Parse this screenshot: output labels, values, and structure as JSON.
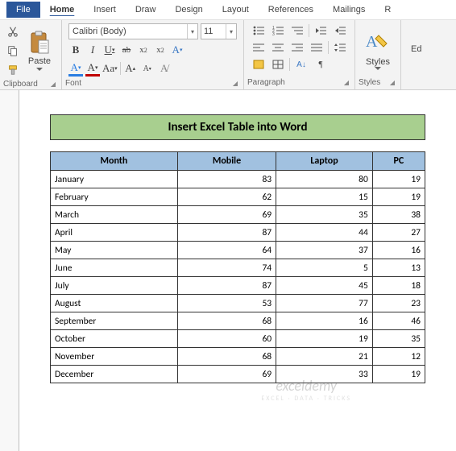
{
  "tabs": {
    "file": "File",
    "home": "Home",
    "insert": "Insert",
    "draw": "Draw",
    "design": "Design",
    "layout": "Layout",
    "references": "References",
    "mailings": "Mailings",
    "r": "R"
  },
  "ribbon": {
    "clipboard": {
      "label": "Clipboard",
      "paste": "Paste"
    },
    "font": {
      "label": "Font",
      "name": "Calibri (Body)",
      "size": "11"
    },
    "paragraph": {
      "label": "Paragraph"
    },
    "styles": {
      "label": "Styles",
      "btn": "Styles"
    },
    "editing": {
      "label": "Ed"
    }
  },
  "document": {
    "title": "Insert Excel Table into Word",
    "headers": [
      "Month",
      "Mobile",
      "Laptop",
      "PC"
    ],
    "rows": [
      {
        "month": "January",
        "mobile": "83",
        "laptop": "80",
        "pc": "19"
      },
      {
        "month": "February",
        "mobile": "62",
        "laptop": "15",
        "pc": "19"
      },
      {
        "month": "March",
        "mobile": "69",
        "laptop": "35",
        "pc": "38"
      },
      {
        "month": "April",
        "mobile": "87",
        "laptop": "44",
        "pc": "27"
      },
      {
        "month": "May",
        "mobile": "64",
        "laptop": "37",
        "pc": "16"
      },
      {
        "month": "June",
        "mobile": "74",
        "laptop": "5",
        "pc": "13"
      },
      {
        "month": "July",
        "mobile": "87",
        "laptop": "45",
        "pc": "18"
      },
      {
        "month": "August",
        "mobile": "53",
        "laptop": "77",
        "pc": "23"
      },
      {
        "month": "September",
        "mobile": "68",
        "laptop": "16",
        "pc": "46"
      },
      {
        "month": "October",
        "mobile": "60",
        "laptop": "19",
        "pc": "35"
      },
      {
        "month": "November",
        "mobile": "68",
        "laptop": "21",
        "pc": "12"
      },
      {
        "month": "December",
        "mobile": "69",
        "laptop": "33",
        "pc": "19"
      }
    ]
  },
  "watermark": {
    "line1": "exceldemy",
    "line2": "EXCEL · DATA · TRICKS"
  }
}
